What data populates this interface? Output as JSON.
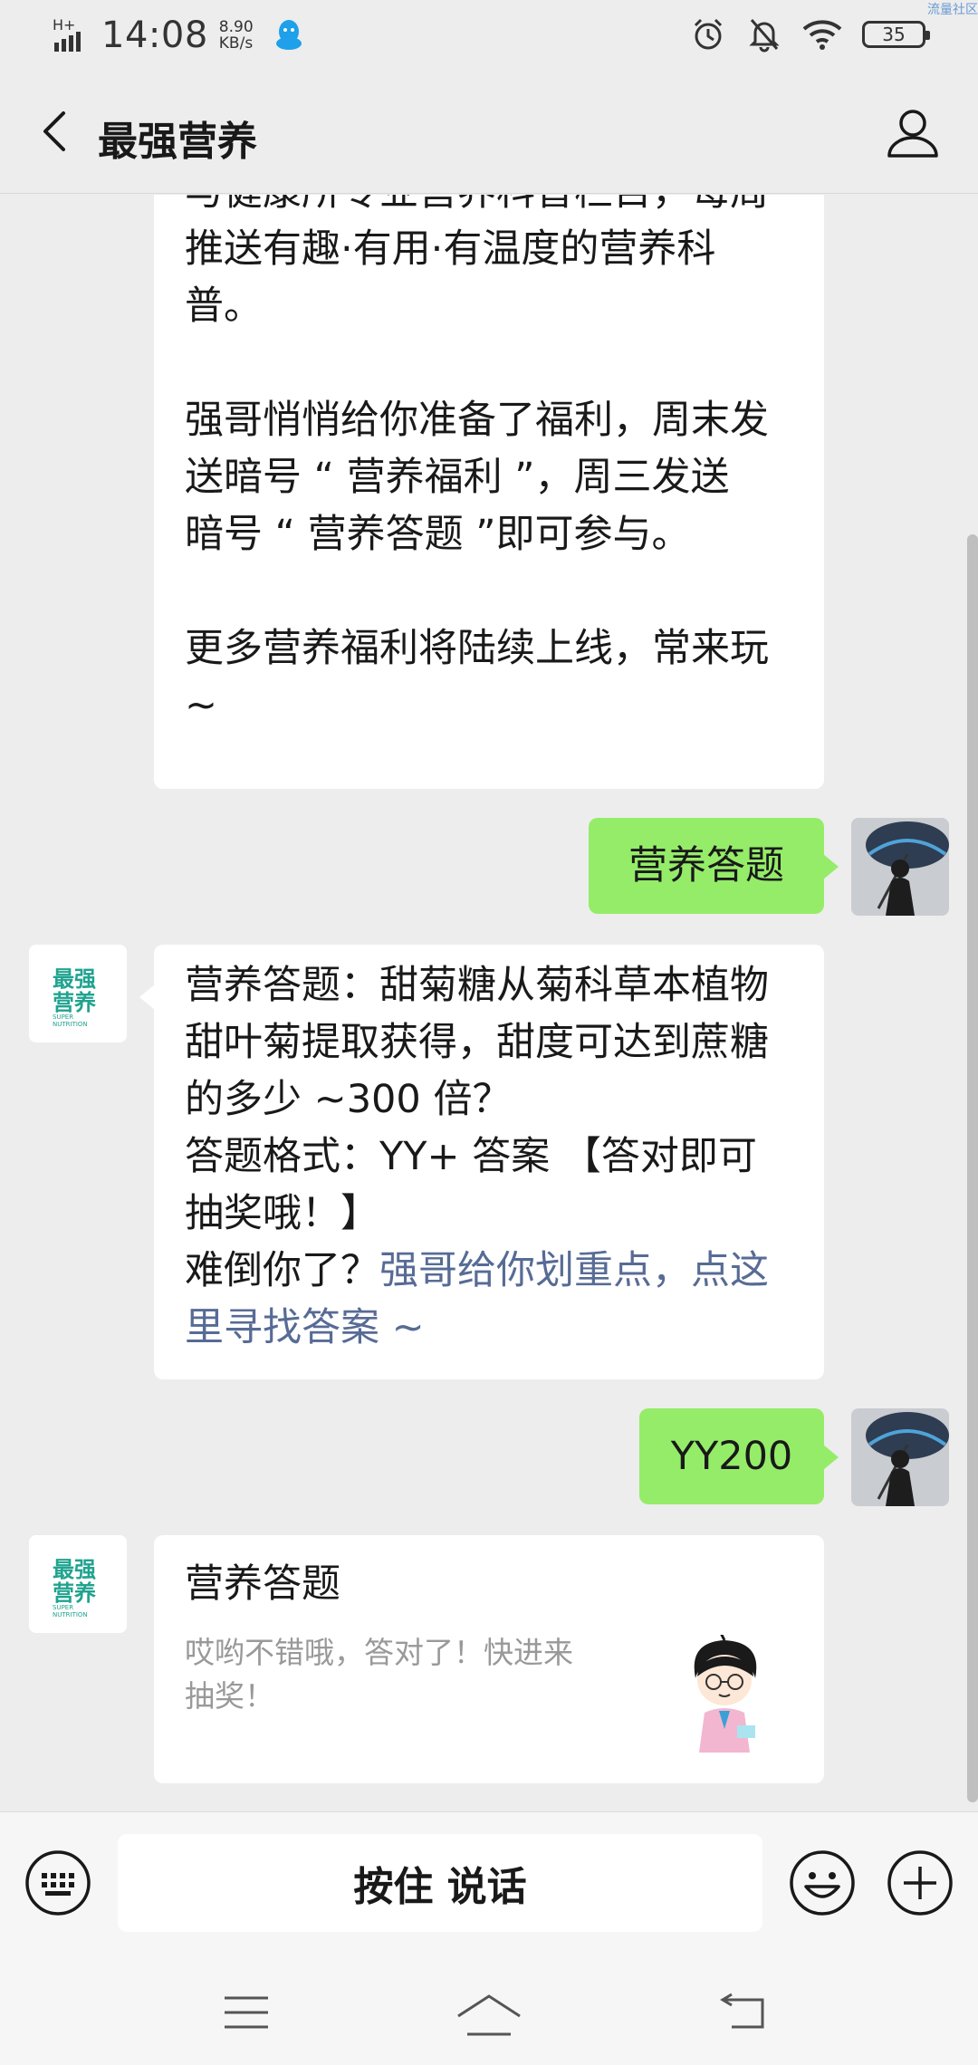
{
  "status_bar": {
    "network": "H+",
    "time": "14:08",
    "speed_value": "8.90",
    "speed_unit": "KB/s",
    "battery": "35",
    "watermark": "流量社区"
  },
  "nav": {
    "title": "最强营养"
  },
  "messages": {
    "intro": {
      "paragraphs": [
        "与健康所专业营养科普栏目，每周\n推送有趣·有用·有温度的营养科\n普。",
        "强哥悄悄给你准备了福利，周末发\n送暗号 “ 营养福利 ”，周三发送\n暗号 “ 营养答题 ”即可参与。",
        "更多营养福利将陆续上线，常来玩\n~"
      ]
    },
    "user_reply_1": "营养答题",
    "question": {
      "text": "营养答题：甜菊糖从菊科草本植物\n甜叶菊提取获得，甜度可达到蔗糖\n的多少 ~300 倍？\n答题格式：YY+ 答案 【答对即可\n抽奖哦！】\n难倒你了？",
      "link": "强哥给你划重点，点这\n里寻找答案 ~"
    },
    "user_reply_2": "YY200",
    "card": {
      "title": "营养答题",
      "desc": "哎哟不错哦，答对了！快进来\n抽奖！"
    }
  },
  "bot_avatar": {
    "line1": "最强",
    "line2": "营养",
    "sub1": "SUPER",
    "sub2": "NUTRITION"
  },
  "input_bar": {
    "hold_talk_label": "按住 说话"
  },
  "colors": {
    "background": "#ededed",
    "user_bubble": "#95ec69",
    "link": "#576b95",
    "brand_teal": "#20a38f"
  }
}
